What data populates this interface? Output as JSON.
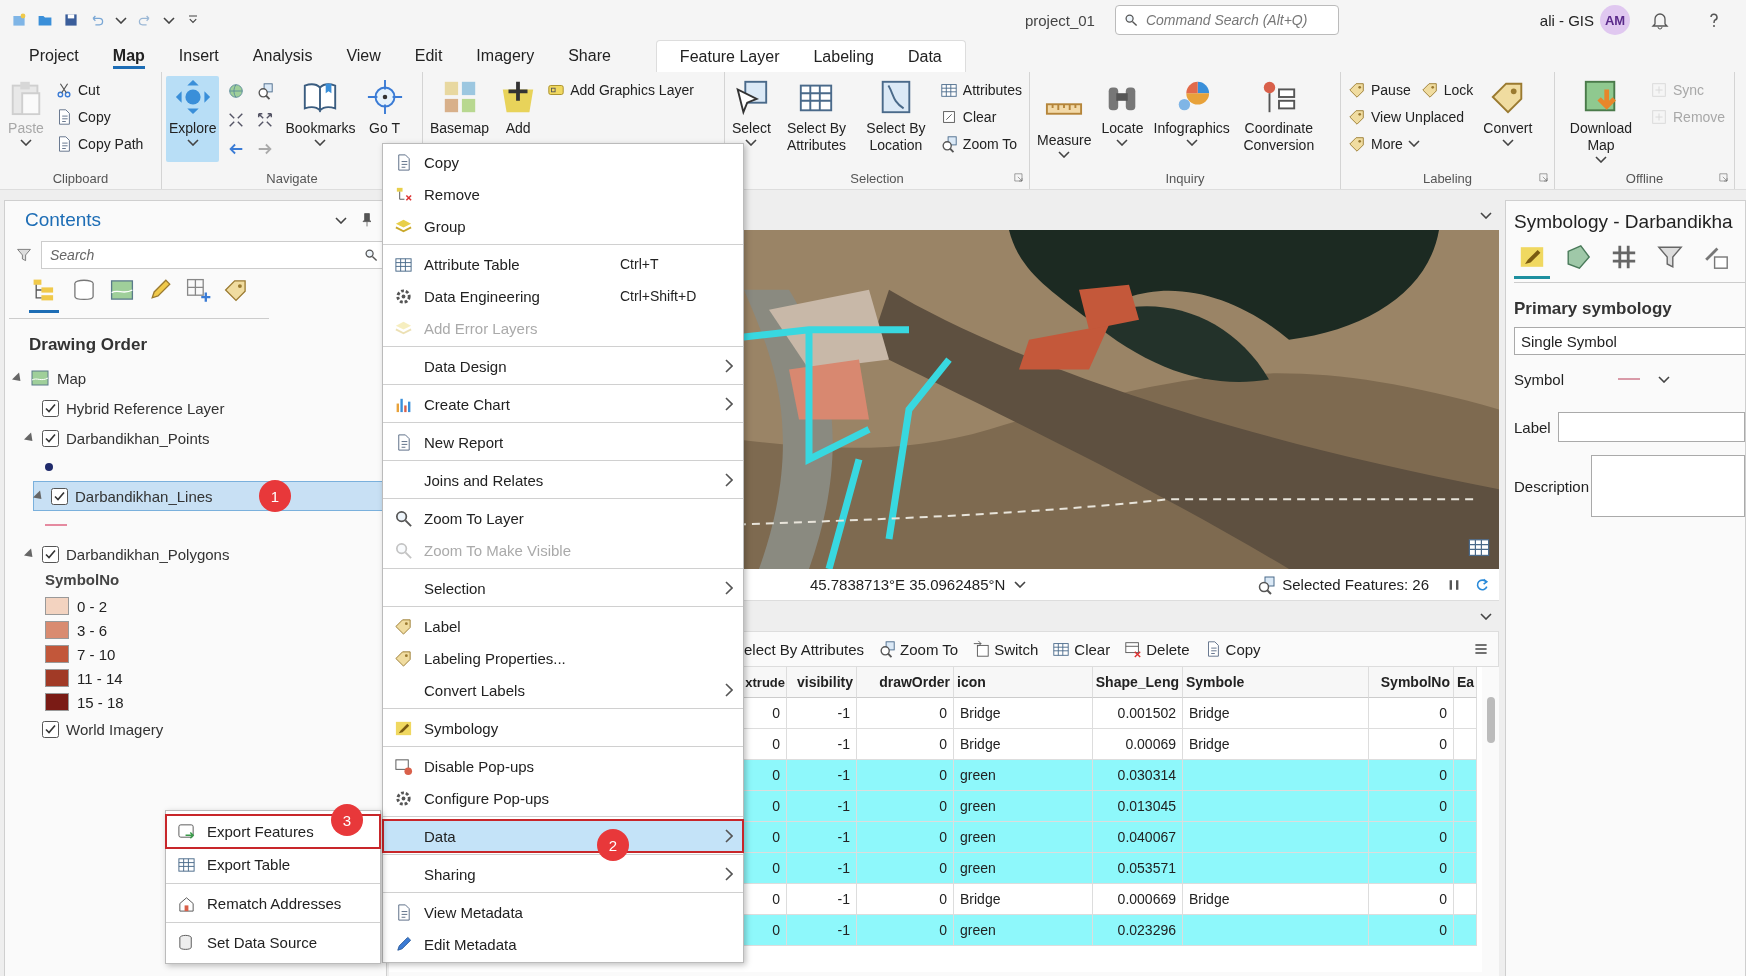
{
  "title_bar": {
    "title": "project_01",
    "command_search": {
      "placeholder": "Command Search (Alt+Q)"
    },
    "user": "ali - GIS",
    "avatar": "AM"
  },
  "ribbon_tabs": [
    {
      "label": "Project",
      "selected": false
    },
    {
      "label": "Map",
      "selected": true
    },
    {
      "label": "Insert",
      "selected": false
    },
    {
      "label": "Analysis",
      "selected": false
    },
    {
      "label": "View",
      "selected": false
    },
    {
      "label": "Edit",
      "selected": false
    },
    {
      "label": "Imagery",
      "selected": false
    },
    {
      "label": "Share",
      "selected": false
    }
  ],
  "contextual_tabs": [
    {
      "label": "Feature Layer",
      "selected": false
    },
    {
      "label": "Labeling",
      "selected": false
    },
    {
      "label": "Data",
      "selected": false
    }
  ],
  "ribbon_groups": [
    {
      "label": "Clipboard",
      "launcher": false,
      "tools": [
        {
          "kind": "large",
          "label": "Paste",
          "disabled": true,
          "selected": false,
          "dropdown": true
        },
        {
          "kind": "small",
          "label": "Cut",
          "disabled": false,
          "selected": false,
          "dropdown": false
        },
        {
          "kind": "small",
          "label": "Copy",
          "disabled": false,
          "selected": false,
          "dropdown": false
        },
        {
          "kind": "small",
          "label": "Copy Path",
          "disabled": false,
          "selected": false,
          "dropdown": false
        }
      ]
    },
    {
      "label": "Navigate",
      "launcher": false,
      "tools": [
        {
          "kind": "large",
          "label": "Explore",
          "disabled": false,
          "selected": true,
          "dropdown": true
        },
        {
          "kind": "nav_grid"
        },
        {
          "kind": "large",
          "label": "Bookmarks",
          "disabled": false,
          "selected": false,
          "dropdown": true
        },
        {
          "kind": "large",
          "label": "Go T",
          "disabled": false,
          "selected": false,
          "dropdown": false
        }
      ]
    },
    {
      "tools": [
        {
          "kind": "large",
          "label": "Basemap",
          "disabled": false,
          "selected": false,
          "dropdown": false
        },
        {
          "kind": "large",
          "label": "Add",
          "disabled": false,
          "selected": false,
          "dropdown": false
        },
        {
          "kind": "small",
          "label": "Add Graphics Layer",
          "disabled": false,
          "selected": false,
          "dropdown": false
        }
      ]
    },
    {
      "label": "Selection",
      "launcher": true,
      "tools": [
        {
          "kind": "large",
          "label": "Select",
          "disabled": false,
          "selected": false,
          "dropdown": true
        },
        {
          "kind": "large",
          "label": "Select By Attributes",
          "disabled": false,
          "selected": false,
          "dropdown": false
        },
        {
          "kind": "large",
          "label": "Select By Location",
          "disabled": false,
          "selected": false,
          "dropdown": false
        },
        {
          "kind": "small",
          "label": "Attributes",
          "disabled": false,
          "selected": false,
          "dropdown": false
        },
        {
          "kind": "small",
          "label": "Clear",
          "disabled": false,
          "selected": false,
          "dropdown": false
        },
        {
          "kind": "small",
          "label": "Zoom To",
          "disabled": false,
          "selected": false,
          "dropdown": false
        }
      ]
    },
    {
      "label": "Inquiry",
      "launcher": false,
      "tools": [
        {
          "kind": "large",
          "label": "Measure",
          "disabled": false,
          "selected": false,
          "dropdown": true
        },
        {
          "kind": "large",
          "label": "Locate",
          "disabled": false,
          "selected": false,
          "dropdown": true
        },
        {
          "kind": "large",
          "label": "Infographics",
          "disabled": false,
          "selected": false,
          "dropdown": true
        },
        {
          "kind": "large",
          "label": "Coordinate Conversion",
          "disabled": false,
          "selected": false,
          "dropdown": false
        }
      ]
    },
    {
      "label": "Labeling",
      "launcher": true,
      "tools": [
        {
          "kind": "small",
          "label": "Pause",
          "disabled": false,
          "selected": false,
          "dropdown": false
        },
        {
          "kind": "small",
          "label": "Lock",
          "disabled": false,
          "selected": false,
          "dropdown": false
        },
        {
          "kind": "small",
          "label": "View Unplaced",
          "disabled": false,
          "selected": false,
          "dropdown": false
        },
        {
          "kind": "small",
          "label": "More",
          "disabled": false,
          "selected": false,
          "dropdown": true
        },
        {
          "kind": "large",
          "label": "Convert",
          "disabled": false,
          "selected": false,
          "dropdown": true
        }
      ]
    },
    {
      "label": "Offline",
      "launcher": true,
      "tools": [
        {
          "kind": "large",
          "label": "Download Map",
          "disabled": false,
          "selected": false,
          "dropdown": true
        },
        {
          "kind": "small",
          "label": "Sync",
          "disabled": true,
          "selected": false,
          "dropdown": false
        },
        {
          "kind": "small",
          "label": "Remove",
          "disabled": true,
          "selected": false,
          "dropdown": false
        }
      ]
    }
  ],
  "contents": {
    "title": "Contents",
    "search": {
      "placeholder": "Search"
    },
    "view_tabs": [
      {
        "selected": true
      },
      {
        "selected": false
      },
      {
        "selected": false
      },
      {
        "selected": false
      },
      {
        "selected": false
      },
      {
        "selected": false
      }
    ],
    "heading": "Drawing Order",
    "tree": [
      {
        "label": "Map",
        "kind": "map",
        "expanded": true,
        "children": [
          {
            "label": "Hybrid Reference Layer",
            "kind": "layer",
            "checked": true,
            "selected": false
          },
          {
            "label": "Darbandikhan_Points",
            "kind": "layer",
            "checked": true,
            "selected": false,
            "expanded": true,
            "legend": {
              "kind": "point",
              "color": "#1f2a6b"
            }
          },
          {
            "label": "Darbandikhan_Lines",
            "kind": "layer",
            "checked": true,
            "selected": true,
            "expanded": true,
            "badge": "1",
            "legend": {
              "kind": "line",
              "color": "#e58aa0"
            }
          },
          {
            "label": "Darbandikhan_Polygons",
            "kind": "layer",
            "checked": true,
            "selected": false,
            "expanded": true,
            "legend": {
              "kind": "classes",
              "field": "SymbolNo",
              "classes": [
                {
                  "label": "0 - 2",
                  "color": "#f3d3c0"
                },
                {
                  "label": "3 - 6",
                  "color": "#d98b70"
                },
                {
                  "label": "7 - 10",
                  "color": "#c2573a"
                },
                {
                  "label": "11 - 14",
                  "color": "#a13a26"
                },
                {
                  "label": "15 - 18",
                  "color": "#7a1b15"
                }
              ]
            }
          },
          {
            "label": "World Imagery",
            "kind": "layer",
            "checked": true,
            "selected": false
          }
        ]
      }
    ]
  },
  "context_menu": {
    "sections": [
      [
        {
          "kind": "command",
          "label": "Copy",
          "disabled": false,
          "selected": false
        },
        {
          "kind": "command",
          "label": "Remove",
          "disabled": false,
          "selected": false
        },
        {
          "kind": "command",
          "label": "Group",
          "disabled": false,
          "selected": false
        }
      ],
      [
        {
          "kind": "command",
          "label": "Attribute Table",
          "shortcut": "Ctrl+T",
          "disabled": false,
          "selected": false
        },
        {
          "kind": "command",
          "label": "Data Engineering",
          "shortcut": "Ctrl+Shift+D",
          "disabled": false,
          "selected": false
        },
        {
          "kind": "command",
          "label": "Add Error Layers",
          "disabled": true,
          "selected": false
        }
      ],
      [
        {
          "kind": "submenu",
          "label": "Data Design",
          "disabled": false,
          "selected": false
        }
      ],
      [
        {
          "kind": "submenu",
          "label": "Create Chart",
          "disabled": false,
          "selected": false
        }
      ],
      [
        {
          "kind": "command",
          "label": "New Report",
          "disabled": false,
          "selected": false
        }
      ],
      [
        {
          "kind": "submenu",
          "label": "Joins and Relates",
          "disabled": false,
          "selected": false
        }
      ],
      [
        {
          "kind": "command",
          "label": "Zoom To Layer",
          "disabled": false,
          "selected": false
        },
        {
          "kind": "command",
          "label": "Zoom To Make Visible",
          "disabled": true,
          "selected": false
        }
      ],
      [
        {
          "kind": "submenu",
          "label": "Selection",
          "disabled": false,
          "selected": false
        }
      ],
      [
        {
          "kind": "command",
          "label": "Label",
          "disabled": false,
          "selected": false
        },
        {
          "kind": "command",
          "label": "Labeling Properties...",
          "disabled": false,
          "selected": false
        },
        {
          "kind": "submenu",
          "label": "Convert Labels",
          "disabled": false,
          "selected": false
        }
      ],
      [
        {
          "kind": "command",
          "label": "Symbology",
          "disabled": false,
          "selected": false
        }
      ],
      [
        {
          "kind": "command",
          "label": "Disable Pop-ups",
          "disabled": false,
          "selected": false
        },
        {
          "kind": "command",
          "label": "Configure Pop-ups",
          "disabled": false,
          "selected": false
        }
      ],
      [
        {
          "kind": "submenu",
          "label": "Data",
          "disabled": false,
          "selected": true,
          "outlined": true,
          "badge": "2"
        }
      ],
      [
        {
          "kind": "submenu",
          "label": "Sharing",
          "disabled": false,
          "selected": false
        }
      ],
      [
        {
          "kind": "command",
          "label": "View Metadata",
          "disabled": false,
          "selected": false
        },
        {
          "kind": "command",
          "label": "Edit Metadata",
          "disabled": false,
          "selected": false
        }
      ]
    ]
  },
  "data_submenu": {
    "sections": [
      [
        {
          "label": "Export Features",
          "selected": false,
          "outlined": true,
          "badge": "3"
        },
        {
          "label": "Export Table",
          "selected": false,
          "outlined": false
        }
      ],
      [
        {
          "label": "Rematch Addresses",
          "selected": false,
          "outlined": false
        }
      ],
      [
        {
          "label": "Set Data Source",
          "selected": false,
          "outlined": false
        }
      ]
    ]
  },
  "map_view": {
    "coordinates": "45.7838713°E 35.0962485°N",
    "selected_features": "Selected Features: 26"
  },
  "attribute_table": {
    "toolbar": [
      "elect By Attributes",
      "Zoom To",
      "Switch",
      "Clear",
      "Delete",
      "Copy"
    ],
    "columns": [
      {
        "label": "xtrude",
        "kind": "number"
      },
      {
        "label": "visibility",
        "kind": "number"
      },
      {
        "label": "drawOrder",
        "kind": "number"
      },
      {
        "label": "icon",
        "kind": "text"
      },
      {
        "label": "Shape_Leng",
        "kind": "number"
      },
      {
        "label": "Symbole",
        "kind": "text"
      },
      {
        "label": "SymbolNo",
        "kind": "number"
      },
      {
        "label": "Ea",
        "kind": "text"
      }
    ],
    "rows": [
      {
        "selected": false,
        "cells": [
          "0",
          "-1",
          "0",
          "Bridge",
          "0.001502",
          "Bridge",
          "0",
          null
        ]
      },
      {
        "selected": false,
        "cells": [
          "0",
          "-1",
          "0",
          "Bridge",
          "0.00069",
          "Bridge",
          "0",
          null
        ]
      },
      {
        "selected": true,
        "cells": [
          "0",
          "-1",
          "0",
          "green",
          "0.030314",
          null,
          "0",
          null
        ]
      },
      {
        "selected": true,
        "cells": [
          "0",
          "-1",
          "0",
          "green",
          "0.013045",
          null,
          "0",
          null
        ]
      },
      {
        "selected": true,
        "cells": [
          "0",
          "-1",
          "0",
          "green",
          "0.040067",
          null,
          "0",
          null
        ]
      },
      {
        "selected": true,
        "cells": [
          "0",
          "-1",
          "0",
          "green",
          "0.053571",
          null,
          "0",
          null
        ]
      },
      {
        "selected": false,
        "cells": [
          "0",
          "-1",
          "0",
          "Bridge",
          "0.000669",
          "Bridge",
          "0",
          null
        ]
      },
      {
        "selected": true,
        "cells": [
          "0",
          "-1",
          "0",
          "green",
          "0.023296",
          null,
          "0",
          null
        ]
      }
    ]
  },
  "symbology": {
    "title": "Symbology - Darbandikha",
    "tabs": [
      {
        "selected": true
      },
      {
        "selected": false
      },
      {
        "selected": false
      },
      {
        "selected": false
      },
      {
        "selected": false
      }
    ],
    "heading": "Primary symbology",
    "renderer": "Single Symbol",
    "symbol_label": "Symbol",
    "label_label": "Label",
    "description_label": "Description"
  }
}
